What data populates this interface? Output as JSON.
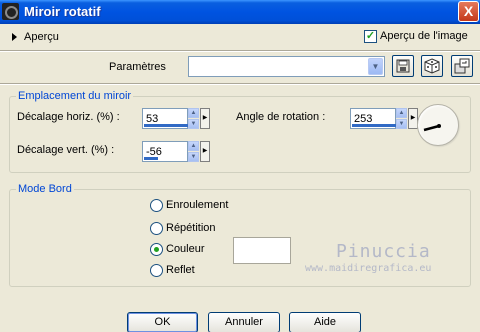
{
  "window": {
    "title": "Miroir rotatif",
    "close_label": "X"
  },
  "preview": {
    "toggle_label": "Aperçu",
    "checkbox_label": "Aperçu de l'image",
    "checkbox_checked": true
  },
  "presets": {
    "label": "Paramètres",
    "value": "",
    "save_icon": "save-icon",
    "random_icon": "dice-icon",
    "reset_icon": "reset-icon"
  },
  "mirror_group": {
    "legend": "Emplacement du miroir",
    "horiz_label": "Décalage horiz. (%) :",
    "horiz_value": "53",
    "vert_label": "Décalage vert. (%) :",
    "vert_value": "-56",
    "angle_label": "Angle de rotation :",
    "angle_value": "253"
  },
  "edge_group": {
    "legend": "Mode Bord",
    "options": [
      {
        "label": "Enroulement",
        "selected": false
      },
      {
        "label": "Répétition",
        "selected": false
      },
      {
        "label": "Couleur",
        "selected": true
      },
      {
        "label": "Reflet",
        "selected": false
      }
    ],
    "color_value": "#ffffff"
  },
  "watermark": {
    "name": "Pinuccia",
    "url": "www.maidiregrafica.eu"
  },
  "buttons": {
    "ok": "OK",
    "cancel": "Annuler",
    "help": "Aide"
  }
}
